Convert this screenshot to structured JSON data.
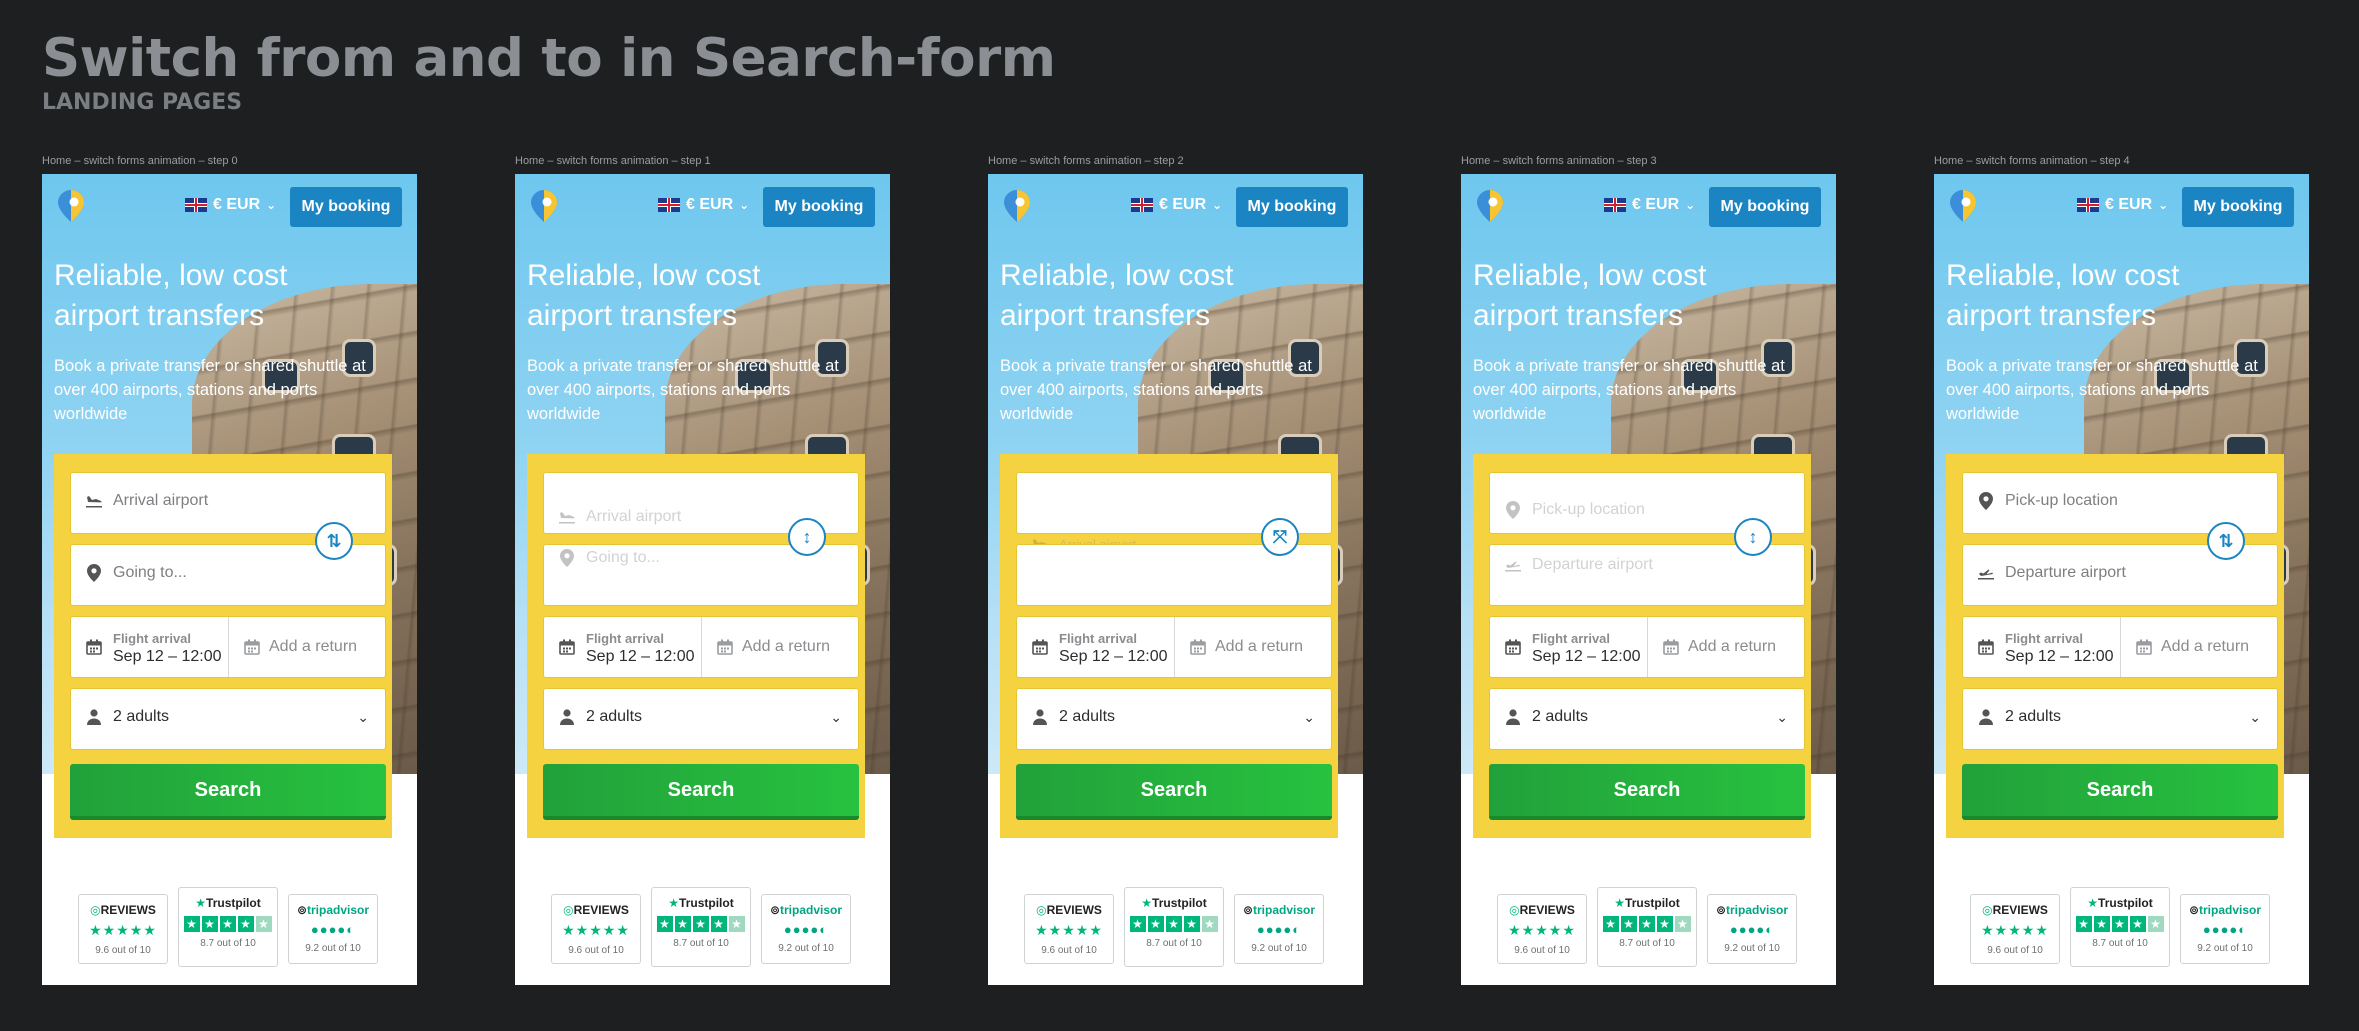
{
  "page": {
    "title": "Switch from and to in Search-form",
    "subtitle": "LANDING PAGES"
  },
  "header": {
    "currency": "€ EUR",
    "booking_label": "My booking"
  },
  "hero": {
    "headline": "Reliable, low cost airport transfers",
    "subline": "Book a private transfer or shared shuttle at over 400 airports, stations and ports worldwide"
  },
  "form": {
    "arrival_placeholder": "Arrival airport",
    "going_placeholder": "Going to...",
    "pickup_placeholder": "Pick-up location",
    "departure_placeholder": "Departure airport",
    "date_label": "Flight arrival",
    "date_value": "Sep 12 – 12:00",
    "return_label": "Add a return",
    "passengers": "2 adults",
    "search_label": "Search"
  },
  "badges": {
    "reviews_title": "REVIEWS",
    "reviews_score": "9.6 out of 10",
    "trustpilot_title": "Trustpilot",
    "trustpilot_score": "8.7 out of 10",
    "tripadvisor_title": "tripadvisor",
    "tripadvisor_score": "9.2 out of 10"
  },
  "frames": [
    {
      "label": "Home – switch forms animation – step 0"
    },
    {
      "label": "Home – switch forms animation – step 1"
    },
    {
      "label": "Home – switch forms animation – step 2"
    },
    {
      "label": "Home – switch forms animation – step 3"
    },
    {
      "label": "Home – switch forms animation – step 4"
    }
  ],
  "icons": {
    "arrival": "plane-landing-icon",
    "location": "map-pin-icon",
    "departure": "plane-takeoff-icon",
    "calendar": "calendar-icon",
    "person": "person-icon",
    "swap": "swap-arrows-icon"
  },
  "colors": {
    "form_bg": "#f5d240",
    "search_green": "#27c23f",
    "brand_blue": "#1b84c2"
  }
}
